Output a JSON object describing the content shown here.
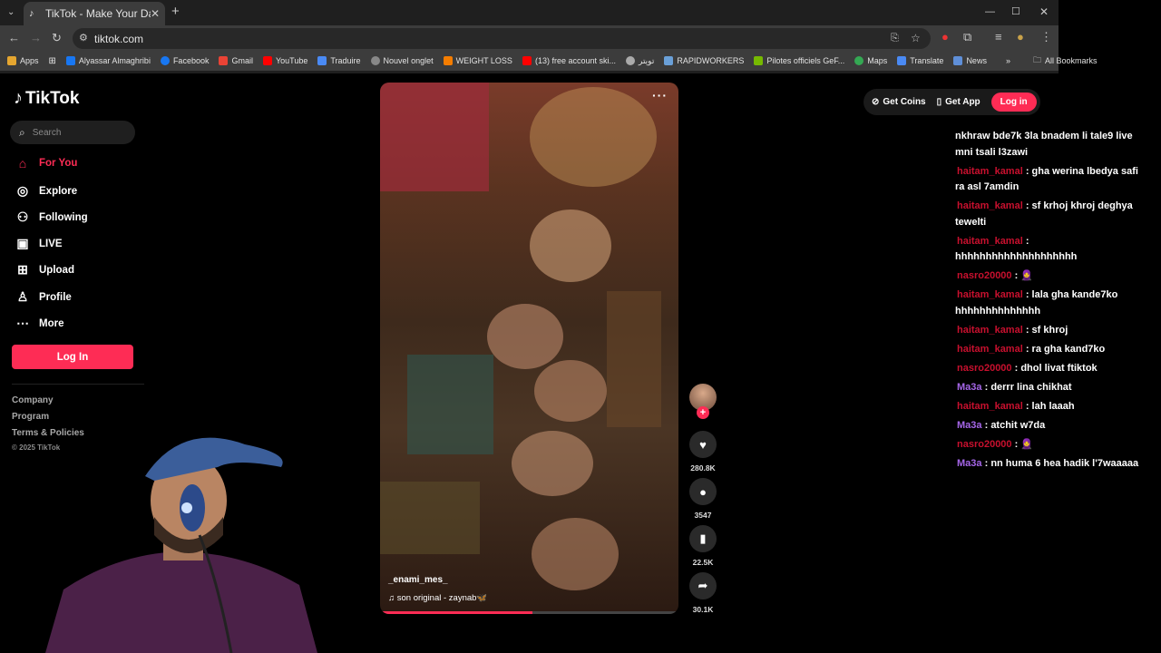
{
  "browser": {
    "tab_title": "TikTok - Make Your Day",
    "url": "tiktok.com",
    "bookmarks": [
      "Apps",
      "Alyassar Almaghribi",
      "Facebook",
      "Gmail",
      "YouTube",
      "Traduire",
      "Nouvel onglet",
      "WEIGHT LOSS",
      "(13) free account ski...",
      "تويتر",
      "RAPIDWORKERS",
      "Pilotes officiels GeF...",
      "Maps",
      "Translate",
      "News"
    ],
    "all_bookmarks": "All Bookmarks"
  },
  "sidebar": {
    "logo": "TikTok",
    "search_placeholder": "Search",
    "nav": [
      "For You",
      "Explore",
      "Following",
      "LIVE",
      "Upload",
      "Profile",
      "More"
    ],
    "login": "Log In",
    "footer": [
      "Company",
      "Program",
      "Terms & Policies"
    ],
    "copyright": "© 2025 TikTok"
  },
  "video": {
    "author": "_enami_mes_",
    "sound": "son original - zaynab🦋",
    "progress": 0.51
  },
  "actions": {
    "likes": "280.8K",
    "comments": "3547",
    "saves": "22.5K",
    "shares": "30.1K"
  },
  "topbar": {
    "get_coins": "Get Coins",
    "get_app": "Get App",
    "login": "Log in"
  },
  "chat": [
    {
      "user": "",
      "text": "nkhraw bde7k 3la bnadem li tale9 live mni tsali l3zawi",
      "color": "#ffffff"
    },
    {
      "user": "haitam_kamal",
      "text": "gha werina lbedya safi ra asl 7amdin",
      "color": "#c8102e"
    },
    {
      "user": "haitam_kamal",
      "text": "sf krhoj khroj deghya tewelti",
      "color": "#c8102e"
    },
    {
      "user": "haitam_kamal",
      "text": "hhhhhhhhhhhhhhhhhhhh",
      "color": "#c8102e"
    },
    {
      "user": "nasro20000",
      "text": "🧕",
      "color": "#c8102e"
    },
    {
      "user": "haitam_kamal",
      "text": "lala gha kande7ko hhhhhhhhhhhhhh",
      "color": "#c8102e"
    },
    {
      "user": "haitam_kamal",
      "text": "sf khroj",
      "color": "#c8102e"
    },
    {
      "user": "haitam_kamal",
      "text": "ra gha kand7ko",
      "color": "#c8102e"
    },
    {
      "user": "nasro20000",
      "text": "dhol livat ftiktok",
      "color": "#c8102e"
    },
    {
      "user": "Ma3a",
      "text": "derrr lina chikhat",
      "color": "#a566e8"
    },
    {
      "user": "haitam_kamal",
      "text": "lah laaah",
      "color": "#c8102e"
    },
    {
      "user": "Ma3a",
      "text": "atchit w7da",
      "color": "#a566e8"
    },
    {
      "user": "nasro20000",
      "text": "🧕",
      "color": "#c8102e"
    },
    {
      "user": "Ma3a",
      "text": "nn huma 6 hea hadik l'7waaaaa",
      "color": "#a566e8"
    }
  ]
}
